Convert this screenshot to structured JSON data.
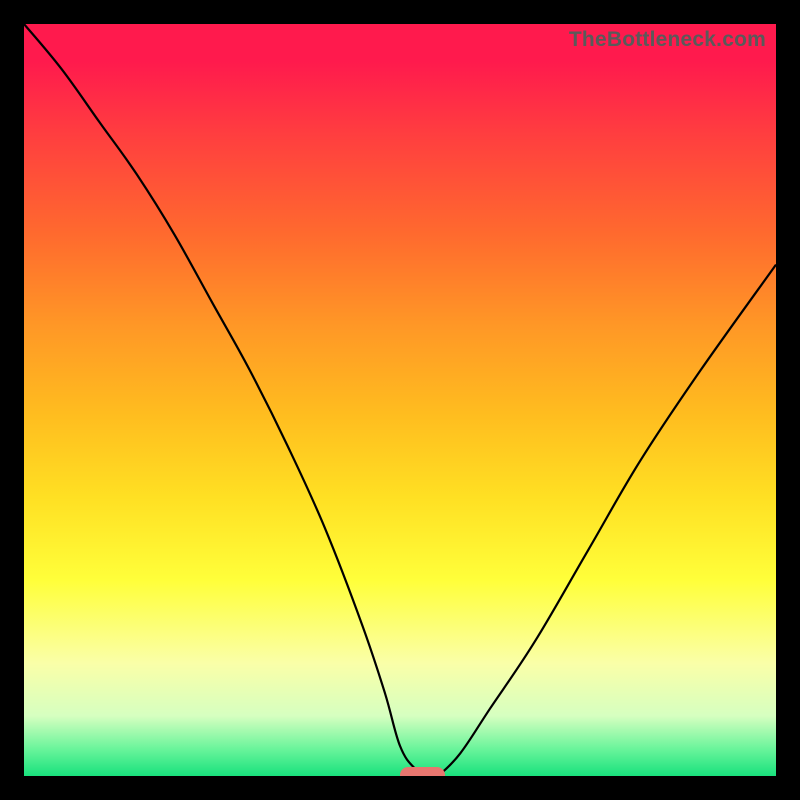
{
  "watermark": "TheBottleneck.com",
  "colors": {
    "page_background": "#000000",
    "curve_stroke": "#000000",
    "marker_fill": "#e8766f",
    "watermark_text": "#5a5a5a"
  },
  "chart_data": {
    "type": "line",
    "title": "",
    "xlabel": "",
    "ylabel": "",
    "xlim": [
      0,
      100
    ],
    "ylim": [
      0,
      100
    ],
    "background_scale": {
      "description": "vertical color gradient representing severity — red (top) = high bottleneck, green (bottom) = no bottleneck",
      "stops": [
        {
          "pct": 0,
          "color": "#ff1a4d",
          "meaning": "severe"
        },
        {
          "pct": 50,
          "color": "#ffbd1f",
          "meaning": "moderate"
        },
        {
          "pct": 85,
          "color": "#faffa8",
          "meaning": "low"
        },
        {
          "pct": 100,
          "color": "#19e17d",
          "meaning": "none"
        }
      ]
    },
    "series": [
      {
        "name": "bottleneck-curve",
        "x": [
          0,
          5,
          10,
          15,
          20,
          25,
          30,
          35,
          40,
          45,
          48,
          50,
          52,
          54,
          55,
          58,
          62,
          68,
          75,
          82,
          90,
          100
        ],
        "y": [
          100,
          94,
          87,
          80,
          72,
          63,
          54,
          44,
          33,
          20,
          11,
          4,
          1,
          0,
          0,
          3,
          9,
          18,
          30,
          42,
          54,
          68
        ]
      }
    ],
    "marker": {
      "name": "optimal-range",
      "x_center": 53,
      "y": 0,
      "width_pct": 6
    }
  }
}
